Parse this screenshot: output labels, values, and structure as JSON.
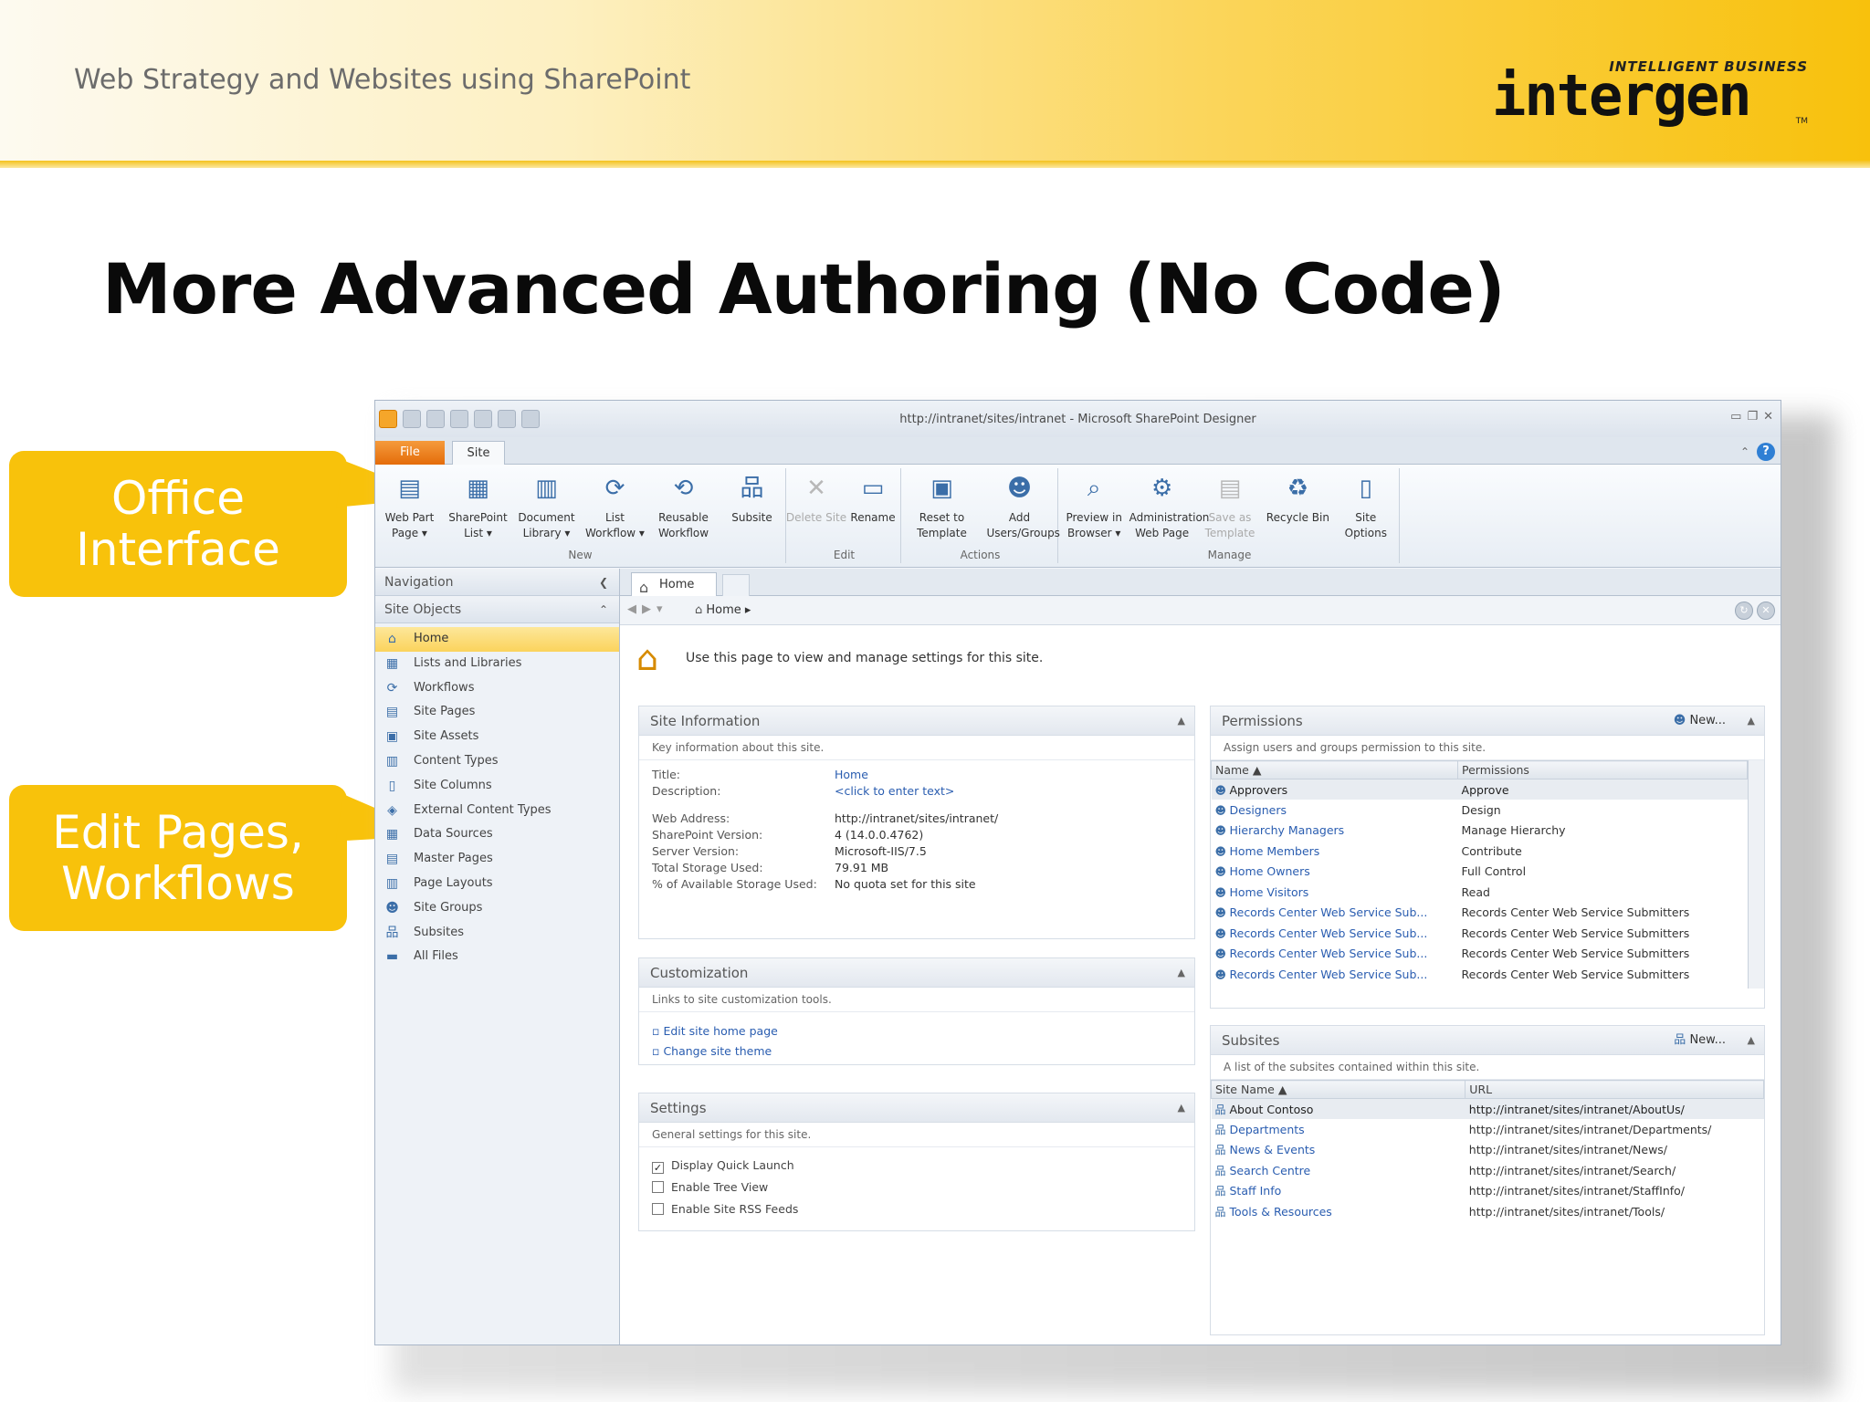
{
  "slide": {
    "header_title": "Web Strategy and Websites using SharePoint",
    "logo_tagline": "INTELLIGENT BUSINESS",
    "logo_word": "intergen",
    "logo_tm": "TM",
    "title": "More Advanced Authoring (No Code)",
    "callouts": {
      "office": [
        "Office",
        "Interface"
      ],
      "edit": [
        "Edit Pages,",
        "Workflows"
      ]
    }
  },
  "app": {
    "window_title": "http://intranet/sites/intranet - Microsoft SharePoint Designer",
    "tabs": {
      "file": "File",
      "site": "Site"
    },
    "ribbon": {
      "groups": [
        {
          "label": "New",
          "buttons": [
            {
              "label": "Web Part Page ▾",
              "icon": "web-part-page-icon",
              "glyph": "▤"
            },
            {
              "label": "SharePoint List ▾",
              "icon": "list-icon",
              "glyph": "▦"
            },
            {
              "label": "Document Library ▾",
              "icon": "document-library-icon",
              "glyph": "▥"
            },
            {
              "label": "List Workflow ▾",
              "icon": "list-workflow-icon",
              "glyph": "⟳"
            },
            {
              "label": "Reusable Workflow",
              "icon": "reusable-workflow-icon",
              "glyph": "⟲"
            },
            {
              "label": "Subsite",
              "icon": "subsite-icon",
              "glyph": "品"
            }
          ]
        },
        {
          "label": "Edit",
          "buttons": [
            {
              "label": "Delete Site",
              "icon": "delete-site-icon",
              "glyph": "✕",
              "disabled": true
            },
            {
              "label": "Rename",
              "icon": "rename-icon",
              "glyph": "▭"
            }
          ]
        },
        {
          "label": "Actions",
          "buttons": [
            {
              "label": "Reset to Template",
              "icon": "reset-template-icon",
              "glyph": "▣"
            },
            {
              "label": "Add Users/Groups",
              "icon": "add-users-icon",
              "glyph": "☻"
            }
          ]
        },
        {
          "label": "Manage",
          "buttons": [
            {
              "label": "Preview in Browser ▾",
              "icon": "preview-browser-icon",
              "glyph": "⌕"
            },
            {
              "label": "Administration Web Page",
              "icon": "administration-icon",
              "glyph": "⚙"
            },
            {
              "label": "Save as Template",
              "icon": "save-template-icon",
              "glyph": "▤",
              "disabled": true
            },
            {
              "label": "Recycle Bin",
              "icon": "recycle-bin-icon",
              "glyph": "♻"
            },
            {
              "label": "Site Options",
              "icon": "site-options-icon",
              "glyph": "▯"
            }
          ]
        }
      ]
    },
    "navigation": {
      "header": "Navigation",
      "section": "Site Objects",
      "items": [
        {
          "label": "Home",
          "icon": "home-icon",
          "glyph": "⌂",
          "selected": true
        },
        {
          "label": "Lists and Libraries",
          "icon": "lists-libraries-icon",
          "glyph": "▦"
        },
        {
          "label": "Workflows",
          "icon": "workflows-icon",
          "glyph": "⟳"
        },
        {
          "label": "Site Pages",
          "icon": "site-pages-icon",
          "glyph": "▤"
        },
        {
          "label": "Site Assets",
          "icon": "site-assets-icon",
          "glyph": "▣"
        },
        {
          "label": "Content Types",
          "icon": "content-types-icon",
          "glyph": "▥"
        },
        {
          "label": "Site Columns",
          "icon": "site-columns-icon",
          "glyph": "▯"
        },
        {
          "label": "External Content Types",
          "icon": "external-content-types-icon",
          "glyph": "◈"
        },
        {
          "label": "Data Sources",
          "icon": "data-sources-icon",
          "glyph": "▦"
        },
        {
          "label": "Master Pages",
          "icon": "master-pages-icon",
          "glyph": "▤"
        },
        {
          "label": "Page Layouts",
          "icon": "page-layouts-icon",
          "glyph": "▥"
        },
        {
          "label": "Site Groups",
          "icon": "site-groups-icon",
          "glyph": "☻"
        },
        {
          "label": "Subsites",
          "icon": "subsites-icon",
          "glyph": "品"
        },
        {
          "label": "All Files",
          "icon": "all-files-icon",
          "glyph": "▬"
        }
      ]
    },
    "doc_tab": "Home",
    "breadcrumb": "Home ▸",
    "intro": "Use this page to view and manage settings for this site.",
    "site_information": {
      "title": "Site Information",
      "desc": "Key information about this site.",
      "rows": [
        {
          "label": "Title:",
          "value": "Home",
          "link": true
        },
        {
          "label": "Description:",
          "value": "<click to enter text>",
          "link": true
        },
        {
          "label": "Web Address:",
          "value": "http://intranet/sites/intranet/"
        },
        {
          "label": "SharePoint Version:",
          "value": "4 (14.0.0.4762)"
        },
        {
          "label": "Server Version:",
          "value": "Microsoft-IIS/7.5"
        },
        {
          "label": "Total Storage Used:",
          "value": "79.91 MB"
        },
        {
          "label": "% of Available Storage Used:",
          "value": "No quota set for this site"
        }
      ]
    },
    "customization": {
      "title": "Customization",
      "desc": "Links to site customization tools.",
      "links": [
        "Edit site home page",
        "Change site theme"
      ]
    },
    "settings": {
      "title": "Settings",
      "desc": "General settings for this site.",
      "options": [
        {
          "label": "Display Quick Launch",
          "checked": true
        },
        {
          "label": "Enable Tree View",
          "checked": false
        },
        {
          "label": "Enable Site RSS Feeds",
          "checked": false
        }
      ]
    },
    "permissions": {
      "title": "Permissions",
      "new_label": "New...",
      "desc": "Assign users and groups permission to this site.",
      "columns": [
        "Name ▲",
        "Permissions"
      ],
      "rows": [
        [
          "Approvers",
          "Approve"
        ],
        [
          "Designers",
          "Design"
        ],
        [
          "Hierarchy Managers",
          "Manage Hierarchy"
        ],
        [
          "Home Members",
          "Contribute"
        ],
        [
          "Home Owners",
          "Full Control"
        ],
        [
          "Home Visitors",
          "Read"
        ],
        [
          "Records Center Web Service Sub...",
          "Records Center Web Service Submitters"
        ],
        [
          "Records Center Web Service Sub...",
          "Records Center Web Service Submitters"
        ],
        [
          "Records Center Web Service Sub...",
          "Records Center Web Service Submitters"
        ],
        [
          "Records Center Web Service Sub...",
          "Records Center Web Service Submitters"
        ]
      ]
    },
    "subsites": {
      "title": "Subsites",
      "new_label": "New...",
      "desc": "A list of the subsites contained within this site.",
      "columns": [
        "Site Name ▲",
        "URL"
      ],
      "rows": [
        [
          "About Contoso",
          "http://intranet/sites/intranet/AboutUs/"
        ],
        [
          "Departments",
          "http://intranet/sites/intranet/Departments/"
        ],
        [
          "News & Events",
          "http://intranet/sites/intranet/News/"
        ],
        [
          "Search Centre",
          "http://intranet/sites/intranet/Search/"
        ],
        [
          "Staff Info",
          "http://intranet/sites/intranet/StaffInfo/"
        ],
        [
          "Tools & Resources",
          "http://intranet/sites/intranet/Tools/"
        ]
      ]
    }
  },
  "colors": {
    "accent_yellow": "#f8c20b",
    "file_tab": "#e46c0a",
    "link": "#2a5db0"
  }
}
